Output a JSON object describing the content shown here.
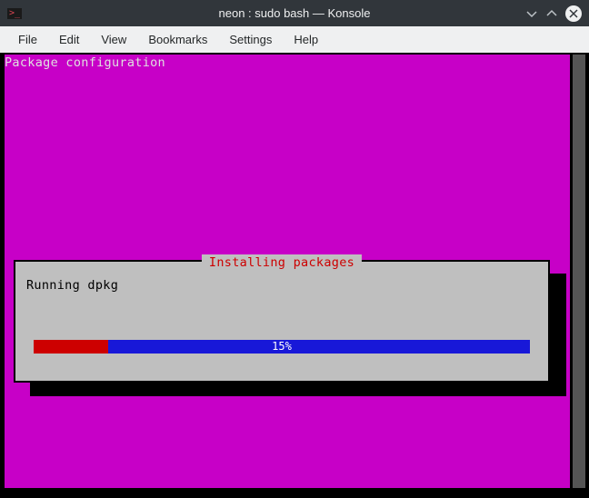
{
  "titlebar": {
    "title": "neon : sudo bash — Konsole"
  },
  "menubar": {
    "items": [
      "File",
      "Edit",
      "View",
      "Bookmarks",
      "Settings",
      "Help"
    ]
  },
  "terminal": {
    "header": "Package configuration",
    "dialog": {
      "title": "Installing packages",
      "message": "Running dpkg",
      "progress_percent": 15,
      "progress_label": "15%"
    }
  }
}
